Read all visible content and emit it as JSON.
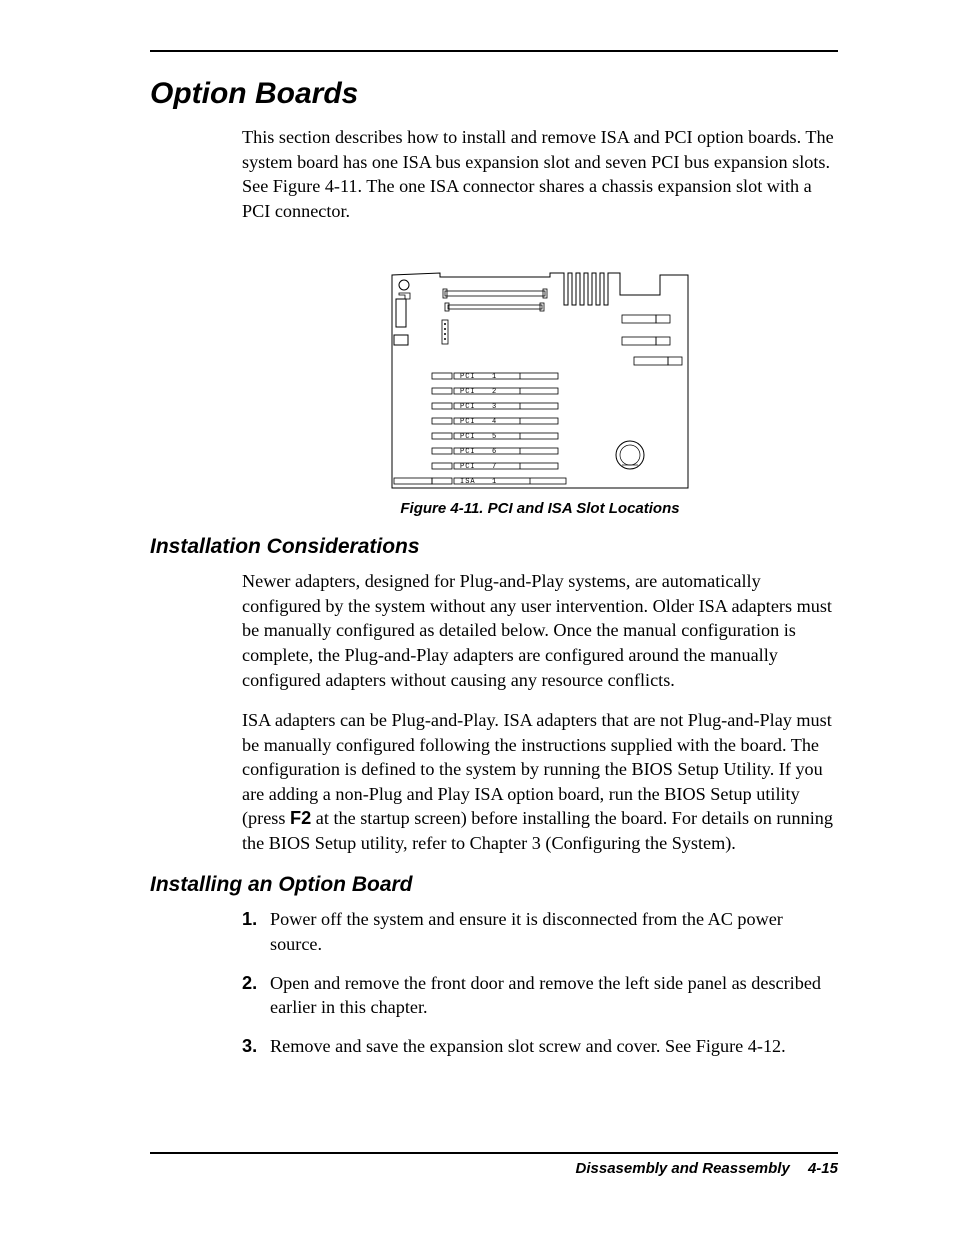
{
  "title": "Option Boards",
  "intro": "This section describes how to install and remove ISA and PCI option boards. The system board has one ISA bus expansion slot and seven PCI bus expansion slots. See Figure 4-11. The one ISA connector shares a chassis expansion slot with a PCI connector.",
  "figure": {
    "caption": "Figure 4-11. PCI and ISA Slot Locations",
    "slots": [
      {
        "label": "PCI",
        "num": "1"
      },
      {
        "label": "PCI",
        "num": "2"
      },
      {
        "label": "PCI",
        "num": "3"
      },
      {
        "label": "PCI",
        "num": "4"
      },
      {
        "label": "PCI",
        "num": "5"
      },
      {
        "label": "PCI",
        "num": "6"
      },
      {
        "label": "PCI",
        "num": "7"
      },
      {
        "label": "ISA",
        "num": "1"
      }
    ]
  },
  "sec1": {
    "heading": "Installation Considerations",
    "p1": "Newer adapters, designed for Plug-and-Play systems, are automatically configured by the system without any user intervention. Older ISA adapters must be manually configured as detailed below. Once the manual configuration is complete, the Plug-and-Play adapters are configured around the manually configured adapters without causing any resource conflicts.",
    "p2a": "ISA adapters can be Plug-and-Play. ISA adapters that are not Plug-and-Play must be manually configured following the instructions supplied with the board. The configuration is defined to the system by running the BIOS Setup Utility. If you are adding a non-Plug and Play ISA option board, run the BIOS Setup utility (press ",
    "p2key": "F2",
    "p2b": " at the startup screen) before installing the board. For details on running the BIOS Setup utility, refer to Chapter 3 (Configuring the System)."
  },
  "sec2": {
    "heading": "Installing an Option Board",
    "steps": [
      {
        "n": "1.",
        "t": "Power off the system and ensure it is disconnected from the AC power source."
      },
      {
        "n": "2.",
        "t": "Open and remove the front door and remove the left side panel as described earlier in this chapter."
      },
      {
        "n": "3.",
        "t": "Remove and save the expansion slot screw and cover. See Figure 4-12."
      }
    ]
  },
  "footer": {
    "section": "Dissasembly and Reassembly",
    "page": "4-15"
  }
}
